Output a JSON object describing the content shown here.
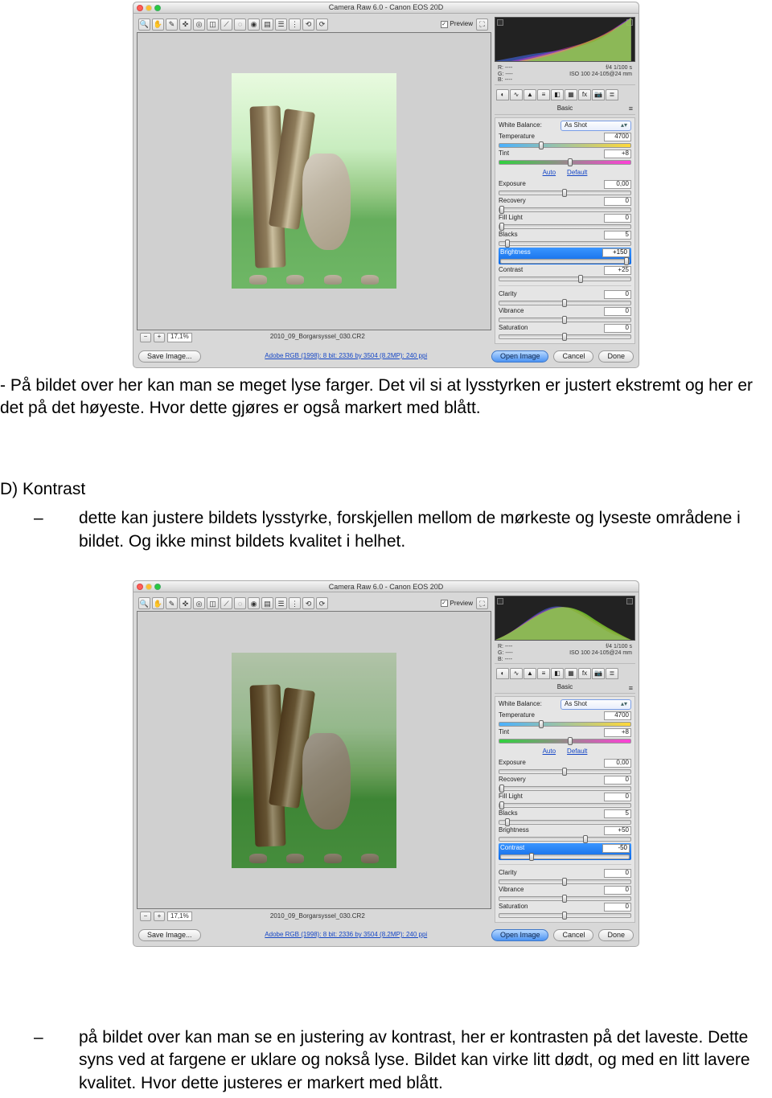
{
  "acr": {
    "title": "Camera Raw 6.0 - Canon EOS 20D",
    "preview_label": "Preview",
    "zoom": "17,1%",
    "filename": "2010_09_Borgarsyssel_030.CR2",
    "bottom_link": "Adobe RGB (1998): 8 bit: 2336 by 3504 (8.2MP): 240 ppi",
    "save_label": "Save Image...",
    "open_label": "Open Image",
    "cancel_label": "Cancel",
    "done_label": "Done",
    "rgblabels": {
      "r": "R:",
      "g": "G:",
      "b": "B:"
    },
    "rgbdash": "----",
    "shutter": "f/4  1/100 s",
    "iso": "ISO 100  24-105@24 mm",
    "panel_name": "Basic",
    "wb_label": "White Balance:",
    "wb_value": "As Shot",
    "temp_label": "Temperature",
    "temp_value": "4700",
    "tint_label": "Tint",
    "tint_value": "+8",
    "auto_label": "Auto",
    "default_label": "Default",
    "exposure_label": "Exposure",
    "exposure_value": "0,00",
    "recovery_label": "Recovery",
    "recovery_value": "0",
    "filllight_label": "Fill Light",
    "filllight_value": "0",
    "blacks_label": "Blacks",
    "blacks_value": "5",
    "brightness_label": "Brightness",
    "contrast_label": "Contrast",
    "clarity_label": "Clarity",
    "clarity_value": "0",
    "vibrance_label": "Vibrance",
    "vibrance_value": "0",
    "saturation_label": "Saturation",
    "saturation_value": "0",
    "s1": {
      "brightness_value": "+150",
      "contrast_value": "+25"
    },
    "s2": {
      "brightness_value": "+50",
      "contrast_value": "-50"
    }
  },
  "text": {
    "para1": "- På bildet over her kan man se meget lyse farger. Det vil si at lysstyrken er justert ekstremt og her er det på det høyeste. Hvor dette gjøres er også markert med blått.",
    "heading_d": "D) Kontrast",
    "bullet_d1": "dette kan justere bildets lysstyrke, forskjellen mellom de mørkeste og lyseste områdene i bildet. Og ikke minst bildets kvalitet i helhet.",
    "bullet_last1": "på bildet over kan man se en justering av kontrast, her er kontrasten på det laveste. Dette syns ved at fargene er uklare og nokså lyse. Bildet kan virke litt dødt, og med en litt lavere kvalitet. Hvor dette justeres er markert med blått."
  }
}
